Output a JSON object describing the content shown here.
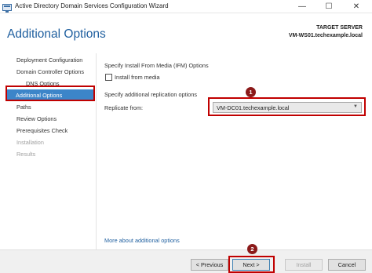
{
  "window": {
    "title": "Active Directory Domain Services Configuration Wizard",
    "controls": {
      "minimize": "—",
      "maximize": "☐",
      "close": "✕"
    }
  },
  "header": {
    "page_title": "Additional Options",
    "target_label": "TARGET SERVER",
    "target_value": "VM-WS01.techexample.local"
  },
  "nav": {
    "items": [
      {
        "label": "Deployment Configuration"
      },
      {
        "label": "Domain Controller Options"
      },
      {
        "label": "DNS Options"
      },
      {
        "label": "Additional Options"
      },
      {
        "label": "Paths"
      },
      {
        "label": "Review Options"
      },
      {
        "label": "Prerequisites Check"
      },
      {
        "label": "Installation"
      },
      {
        "label": "Results"
      }
    ]
  },
  "main": {
    "ifm_heading": "Specify Install From Media (IFM) Options",
    "ifm_checkbox_label": "Install from media",
    "replication_heading": "Specify additional replication options",
    "replicate_from_label": "Replicate from:",
    "replicate_from_value": "VM-DC01.techexample.local",
    "more_link": "More about additional options"
  },
  "footer": {
    "previous": "< Previous",
    "next": "Next >",
    "install": "Install",
    "cancel": "Cancel"
  },
  "annotations": {
    "badge1": "1",
    "badge2": "2"
  },
  "colors": {
    "accent": "#1f5f9f",
    "nav_active": "#3c85c9",
    "highlight": "#c00000",
    "badge": "#8b1a1a"
  }
}
